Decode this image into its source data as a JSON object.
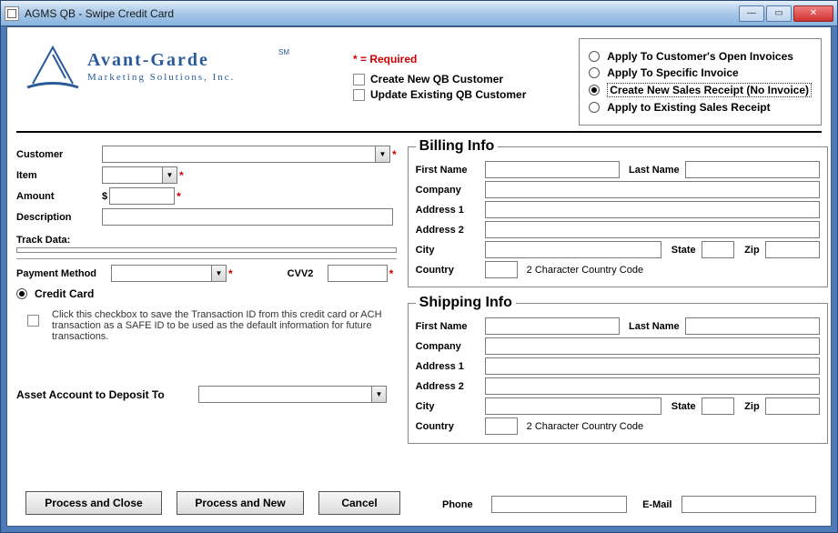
{
  "window": {
    "title": "AGMS QB - Swipe Credit Card"
  },
  "logo": {
    "line1": "Avant-Garde",
    "sm": "SM",
    "line2": "Marketing Solutions, Inc."
  },
  "required_hint": "* = Required",
  "qb_customer": {
    "create": "Create New QB Customer",
    "update": "Update Existing QB Customer"
  },
  "apply_options": {
    "open_invoices": "Apply To Customer's Open Invoices",
    "specific_invoice": "Apply To Specific Invoice",
    "new_receipt": "Create New Sales Receipt (No Invoice)",
    "existing_receipt": "Apply to Existing Sales Receipt",
    "selected": "new_receipt"
  },
  "left": {
    "customer_label": "Customer",
    "item_label": "Item",
    "amount_label": "Amount",
    "amount_prefix": "$",
    "description_label": "Description",
    "track_label": "Track Data:",
    "payment_method_label": "Payment Method",
    "cvv2_label": "CVV2",
    "credit_card_radio": "Credit Card",
    "save_checkbox_desc": "Click this checkbox to save the Transaction ID from this credit card or ACH transaction as a SAFE ID to be used as the default information for future transactions.",
    "asset_label": "Asset Account to Deposit To"
  },
  "billing": {
    "legend": "Billing Info",
    "first_name": "First Name",
    "last_name": "Last Name",
    "company": "Company",
    "address1": "Address 1",
    "address2": "Address 2",
    "city": "City",
    "state": "State",
    "zip": "Zip",
    "country": "Country",
    "country_hint": "2 Character Country Code"
  },
  "shipping": {
    "legend": "Shipping Info",
    "first_name": "First Name",
    "last_name": "Last Name",
    "company": "Company",
    "address1": "Address 1",
    "address2": "Address 2",
    "city": "City",
    "state": "State",
    "zip": "Zip",
    "country": "Country",
    "country_hint": "2 Character Country Code"
  },
  "contact": {
    "phone": "Phone",
    "email": "E-Mail"
  },
  "buttons": {
    "process_close": "Process and Close",
    "process_new": "Process and New",
    "cancel": "Cancel"
  }
}
